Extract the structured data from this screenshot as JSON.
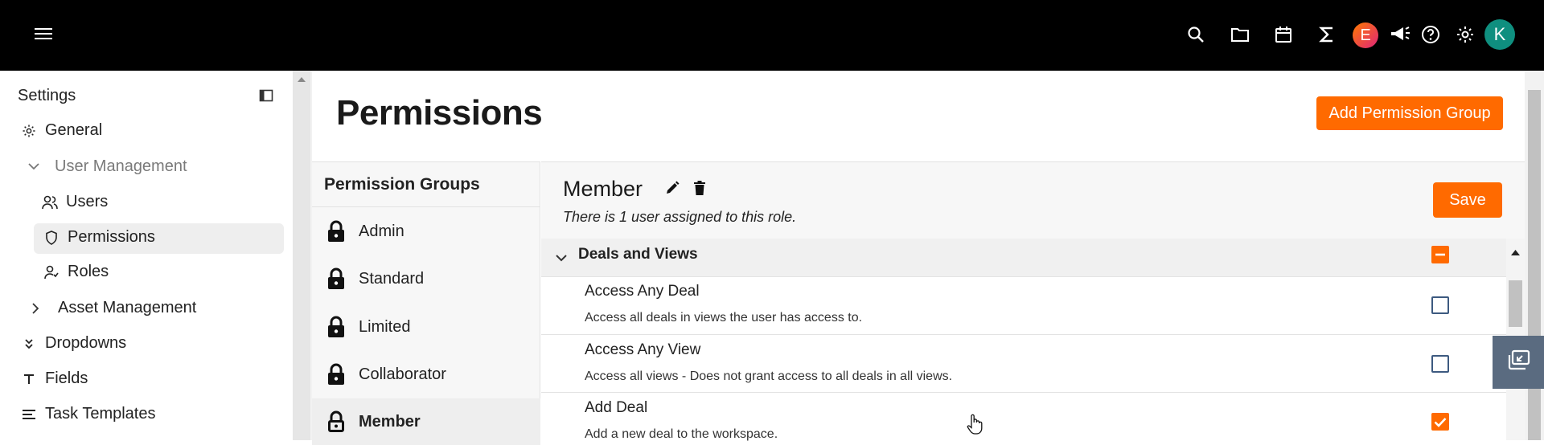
{
  "topbar": {
    "avatar_e": "E",
    "avatar_k": "K",
    "icons": [
      "menu-icon",
      "search-icon",
      "folder-icon",
      "calendar-icon",
      "sigma-icon",
      "megaphone-icon",
      "help-icon",
      "gear-icon"
    ]
  },
  "sidebar": {
    "title": "Settings",
    "items": [
      {
        "label": "General"
      },
      {
        "label": "User Management"
      },
      {
        "label": "Users"
      },
      {
        "label": "Permissions"
      },
      {
        "label": "Roles"
      },
      {
        "label": "Asset Management"
      },
      {
        "label": "Dropdowns"
      },
      {
        "label": "Fields"
      },
      {
        "label": "Task Templates"
      }
    ]
  },
  "page": {
    "title": "Permissions",
    "add_button": "Add Permission Group"
  },
  "permission_groups": {
    "title": "Permission Groups",
    "items": [
      {
        "label": "Admin"
      },
      {
        "label": "Standard"
      },
      {
        "label": "Limited"
      },
      {
        "label": "Collaborator"
      },
      {
        "label": "Member"
      }
    ],
    "selected": "Member"
  },
  "role": {
    "name": "Member",
    "subtitle": "There is 1 user assigned to this role.",
    "save_label": "Save"
  },
  "section": {
    "title": "Deals and Views",
    "state": "partial"
  },
  "permissions": [
    {
      "name": "Access Any Deal",
      "description": "Access all deals in views the user has access to.",
      "checked": false
    },
    {
      "name": "Access Any View",
      "description": "Access all views - Does not grant access to all deals in all views.",
      "checked": false
    },
    {
      "name": "Add Deal",
      "description": "Add a new deal to the workspace.",
      "checked": true
    }
  ],
  "colors": {
    "accent": "#ff6a00",
    "topbar": "#000000",
    "checkbox_border": "#3d5a80"
  }
}
